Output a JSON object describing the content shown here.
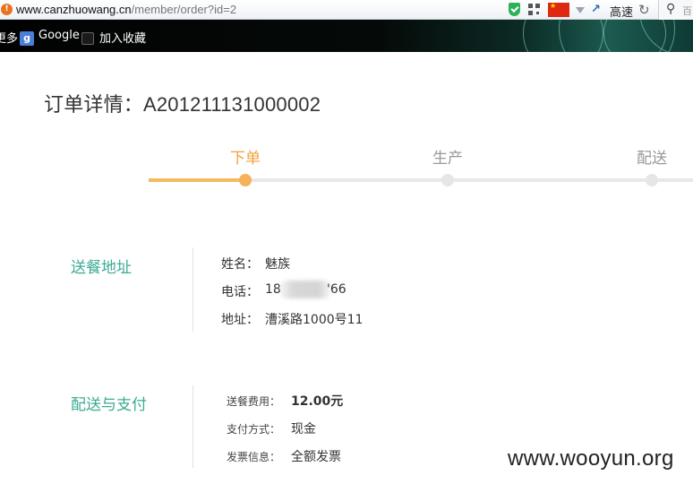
{
  "browser": {
    "url_host": "www.canzhuowang.cn",
    "url_path": "/member/order?id=2",
    "speed_label": "高速",
    "search_placeholder": "百"
  },
  "bookmarks": {
    "more_label": "更多",
    "google_label": "Google",
    "add_favorite_label": "加入收藏"
  },
  "page": {
    "title": "订单详情：A201211131000002"
  },
  "progress": {
    "steps": [
      {
        "label": "下单",
        "active": true
      },
      {
        "label": "生产",
        "active": false
      },
      {
        "label": "配送",
        "active": false
      }
    ]
  },
  "delivery": {
    "section_title": "送餐地址",
    "name_label": "姓名：",
    "name_value": "魅族",
    "phone_label": "电话：",
    "phone_prefix": "18",
    "phone_suffix": "'66",
    "address_label": "地址：",
    "address_value": "漕溪路1000号11"
  },
  "payment": {
    "section_title": "配送与支付",
    "fee_label": "送餐费用：",
    "fee_value": "12.00元",
    "method_label": "支付方式：",
    "method_value": "现金",
    "invoice_label": "发票信息：",
    "invoice_value": "全额发票"
  },
  "watermark": {
    "text": "www.wooyun.org"
  },
  "colors": {
    "accent_orange": "#f0a23a",
    "accent_green": "#3bab93"
  }
}
